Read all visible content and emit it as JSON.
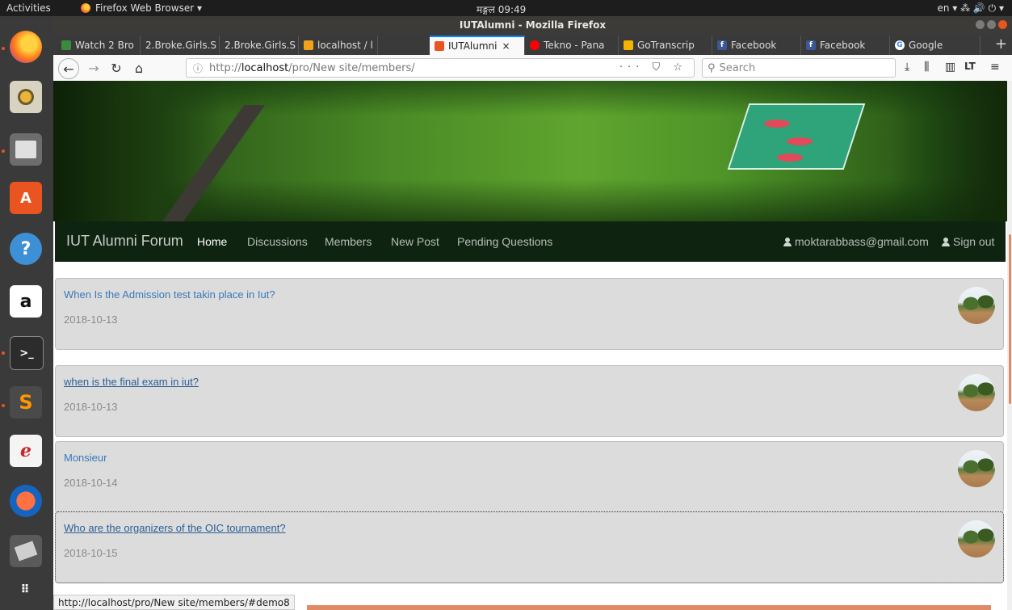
{
  "topbar": {
    "activities": "Activities",
    "app_menu": "Firefox Web Browser ▾",
    "clock": "मङ्गल 09:49",
    "indicators": "en ▾   ⁂  🔊  ⏻ ▾"
  },
  "window": {
    "title": "IUTAlumni - Mozilla Firefox"
  },
  "tabs": [
    {
      "label": "Watch 2 Bro",
      "favicon_color": "#3b8a3e"
    },
    {
      "label": "2.Broke.Girls.S",
      "favicon_color": ""
    },
    {
      "label": "2.Broke.Girls.S",
      "favicon_color": ""
    },
    {
      "label": "localhost / l",
      "favicon_color": "#f0a21b"
    },
    {
      "label": "IUTAlumni",
      "favicon_color": "#e95420",
      "active": true
    },
    {
      "label": "Tekno - Pana",
      "favicon_color": "#ff0000"
    },
    {
      "label": "GoTranscrip",
      "favicon_color": "#f4b400"
    },
    {
      "label": "Facebook",
      "favicon_color": "#3b5998",
      "favicon_glyph": "f"
    },
    {
      "label": "Facebook",
      "favicon_color": "#3b5998",
      "favicon_glyph": "f"
    },
    {
      "label": "Google",
      "favicon_color": "#4285f4",
      "favicon_glyph": "G"
    }
  ],
  "navbar": {
    "url_prefix": "http://",
    "url_host": "localhost",
    "url_path": "/pro/New site/members/",
    "url_actions": "··· ⛉ ☆",
    "search_placeholder": "Search"
  },
  "site": {
    "brand": "IUT Alumni Forum",
    "nav": [
      "Home",
      "Discussions",
      "Members",
      "New Post",
      "Pending Questions"
    ],
    "user_email": "moktarabbass@gmail.com",
    "sign_out": "Sign out"
  },
  "posts": [
    {
      "title": "When Is the Admission test takin place in Iut?",
      "date": "2018-10-13"
    },
    {
      "title": "when is the final exam in iut?",
      "date": "2018-10-13"
    },
    {
      "title": "Monsieur",
      "date": "2018-10-14"
    },
    {
      "title": "Who are the organizers of the OIC tournament?",
      "date": "2018-10-15"
    }
  ],
  "status_bar": {
    "link_url": "http://localhost/pro/New site/members/#demo8"
  },
  "colors": {
    "accent": "#e95420",
    "nav_bg": "#0f2410",
    "link": "#3a79b8",
    "post_bg": "#dcdcdc"
  }
}
